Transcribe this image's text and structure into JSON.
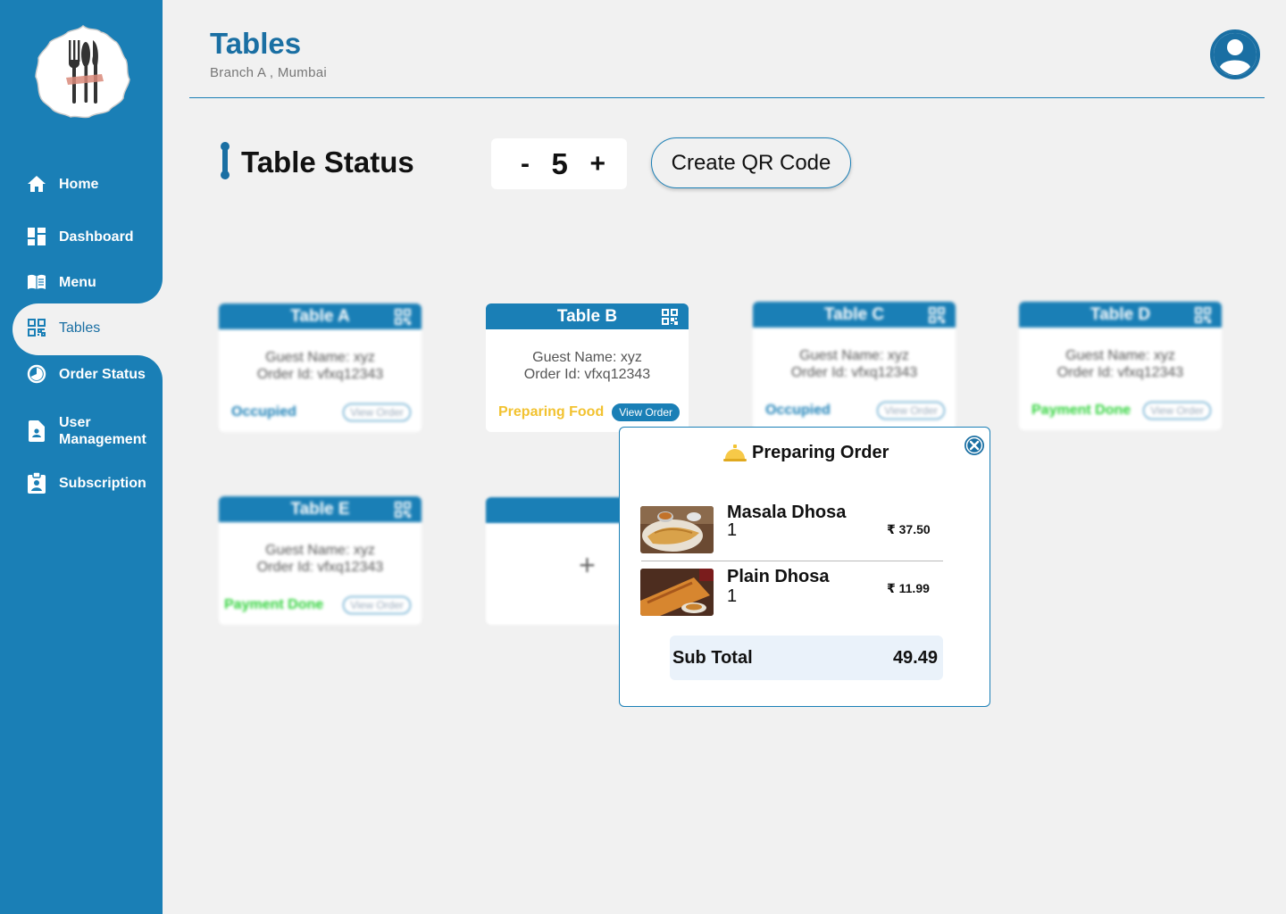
{
  "sidebar": {
    "items": [
      {
        "label": "Home",
        "icon": "home-icon"
      },
      {
        "label": "Dashboard",
        "icon": "dashboard-icon"
      },
      {
        "label": "Menu",
        "icon": "menu-book-icon"
      },
      {
        "label": "Tables",
        "icon": "qr-grid-icon",
        "active": true
      },
      {
        "label": "Order Status",
        "icon": "clock-icon"
      },
      {
        "label": "User Management",
        "icon": "user-badge-icon"
      },
      {
        "label": "Subscription",
        "icon": "clipboard-user-icon"
      }
    ]
  },
  "header": {
    "title": "Tables",
    "subtitle": "Branch A , Mumbai"
  },
  "toolbar": {
    "section_title": "Table Status",
    "stepper": {
      "minus": "-",
      "value": "5",
      "plus": "+"
    },
    "qr_button": "Create QR Code"
  },
  "tables": [
    {
      "name": "Table A",
      "guest": "Guest Name: xyz",
      "order": "Order Id: vfxq12343",
      "status": "Occupied",
      "button": "View Order"
    },
    {
      "name": "Table B",
      "guest": "Guest Name: xyz",
      "order": "Order Id: vfxq12343",
      "status": "Preparing Food",
      "button": "View Order"
    },
    {
      "name": "Table C",
      "guest": "Guest Name: xyz",
      "order": "Order Id: vfxq12343",
      "status": "Occupied",
      "button": "View Order"
    },
    {
      "name": "Table D",
      "guest": "Guest Name: xyz",
      "order": "Order Id: vfxq12343",
      "status": "Payment Done",
      "button": "View Order"
    },
    {
      "name": "Table E",
      "guest": "Guest Name: xyz",
      "order": "Order Id: vfxq12343",
      "status": "Payment Done",
      "button": "View Order"
    }
  ],
  "add_table": {
    "label": "+"
  },
  "popup": {
    "title": "Preparing Order",
    "items": [
      {
        "name": "Masala Dhosa",
        "qty": "1",
        "price": "₹ 37.50"
      },
      {
        "name": "Plain Dhosa",
        "qty": "1",
        "price": "₹ 11.99"
      }
    ],
    "subtotal_label": "Sub Total",
    "subtotal_value": "49.49"
  },
  "colors": {
    "primary": "#1a7fb6",
    "occupied": "#1a7fb6",
    "preparing": "#f2c230",
    "payment_done": "#2fd23a"
  }
}
